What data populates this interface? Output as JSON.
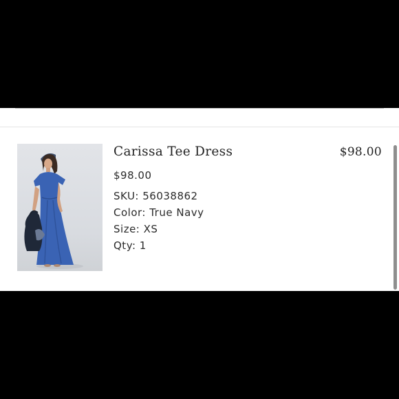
{
  "cart_item": {
    "name": "Carissa Tee Dress",
    "unit_price": "$98.00",
    "line_total": "$98.00",
    "sku": "SKU: 56038862",
    "color": "Color: True Navy",
    "size": "Size: XS",
    "quantity": "Qty: 1"
  },
  "colors": {
    "dress": "#3a63b4",
    "background": "#ffffff",
    "letterbox": "#000000"
  }
}
